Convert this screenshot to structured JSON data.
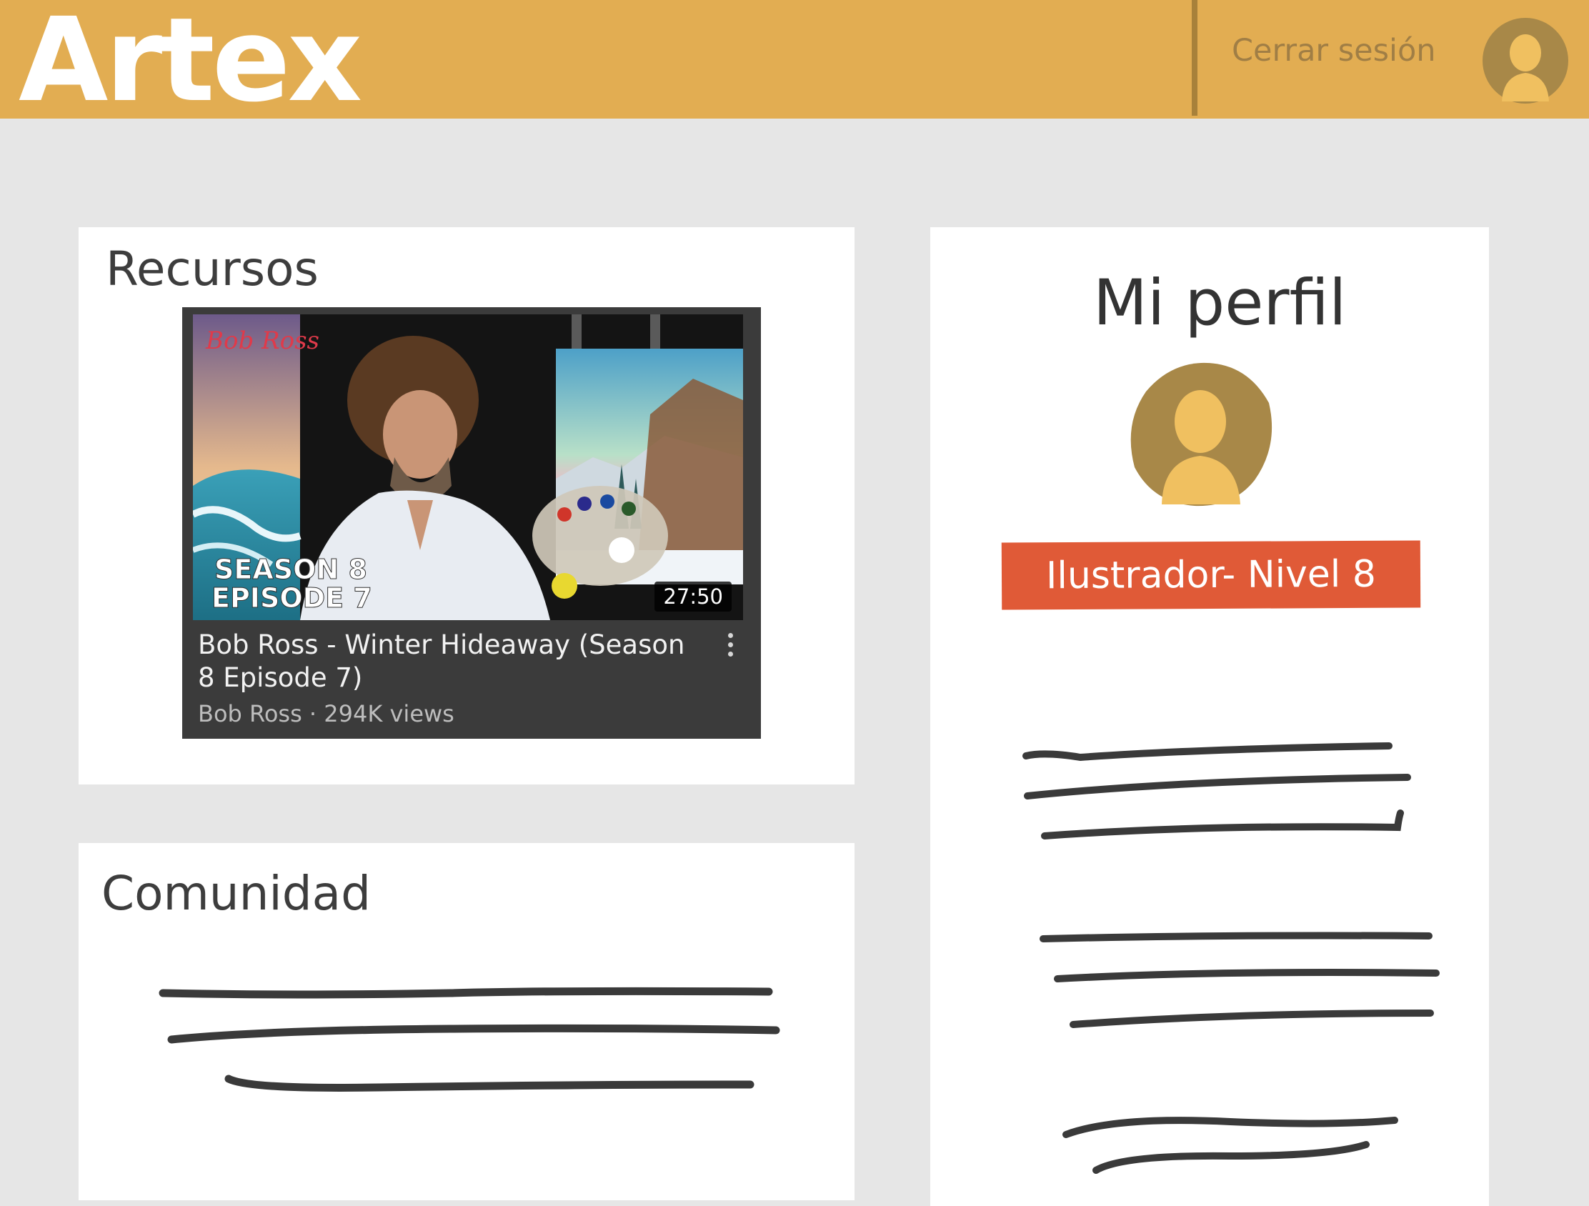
{
  "header": {
    "brand": "Artex",
    "logout_label": "Cerrar sesión",
    "avatar_icon": "user-avatar-icon"
  },
  "resources": {
    "title": "Recursos",
    "video": {
      "title": "Bob Ross - Winter Hideaway (Season 8 Episode 7)",
      "channel": "Bob Ross",
      "views": "294K views",
      "meta": "Bob Ross · 294K views",
      "duration": "27:50",
      "thumbnail_logo": "Bob Ross",
      "thumbnail_line1": "SEASON 8",
      "thumbnail_line2": "EPISODE 7",
      "menu_icon": "more-vert-icon"
    }
  },
  "community": {
    "title": "Comunidad"
  },
  "profile": {
    "title": "Mi perfil",
    "avatar_icon": "user-avatar-icon",
    "level": "Ilustrador- Nivel 8"
  },
  "colors": {
    "header": "#e2ad52",
    "background": "#e6e6e6",
    "card": "#ffffff",
    "avatar_outer": "#a88848",
    "avatar_inner": "#f0c060",
    "badge": "#e05a37",
    "ink": "#3d3d3d"
  }
}
